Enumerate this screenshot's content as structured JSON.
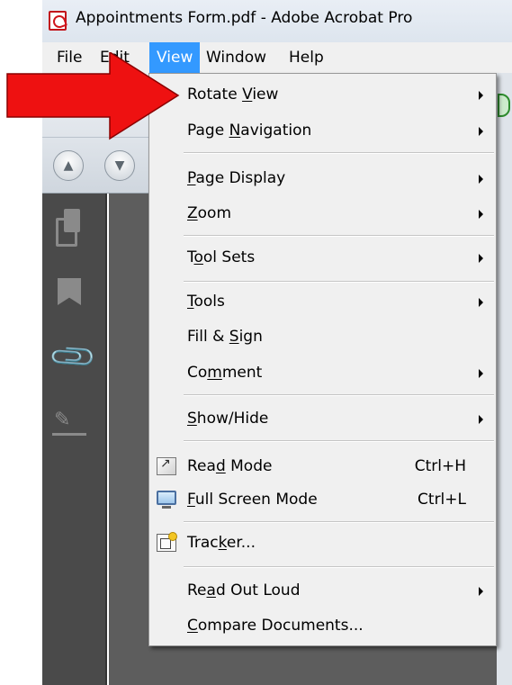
{
  "window": {
    "title": "Appointments Form.pdf - Adobe Acrobat Pro"
  },
  "menubar": {
    "items": [
      {
        "label": "File"
      },
      {
        "label": "Edit"
      },
      {
        "label": "View",
        "active": true
      },
      {
        "label": "Window"
      },
      {
        "label": "Help"
      }
    ]
  },
  "view_menu": {
    "items": [
      {
        "label_pre": "Rotate ",
        "mnemonic": "V",
        "label_post": "iew",
        "submenu": true
      },
      {
        "label_pre": "Page ",
        "mnemonic": "N",
        "label_post": "avigation",
        "submenu": true
      },
      {
        "label_pre": "",
        "mnemonic": "P",
        "label_post": "age Display",
        "submenu": true
      },
      {
        "label_pre": "",
        "mnemonic": "Z",
        "label_post": "oom",
        "submenu": true
      },
      {
        "label_pre": "T",
        "mnemonic": "o",
        "label_post": "ol Sets",
        "submenu": true
      },
      {
        "label_pre": "",
        "mnemonic": "T",
        "label_post": "ools",
        "submenu": true
      },
      {
        "label_pre": "Fill & ",
        "mnemonic": "S",
        "label_post": "ign",
        "submenu": false
      },
      {
        "label_pre": "Co",
        "mnemonic": "m",
        "label_post": "ment",
        "submenu": true
      },
      {
        "label_pre": "",
        "mnemonic": "S",
        "label_post": "how/Hide",
        "submenu": true
      },
      {
        "label_pre": "Rea",
        "mnemonic": "d",
        "label_post": " Mode",
        "shortcut": "Ctrl+H",
        "icon": "read-mode-icon"
      },
      {
        "label_pre": "",
        "mnemonic": "F",
        "label_post": "ull Screen Mode",
        "shortcut": "Ctrl+L",
        "icon": "full-screen-icon"
      },
      {
        "label_pre": "Trac",
        "mnemonic": "k",
        "label_post": "er...",
        "icon": "tracker-icon"
      },
      {
        "label_pre": "Re",
        "mnemonic": "a",
        "label_post": "d Out Loud",
        "submenu": true
      },
      {
        "label_pre": "",
        "mnemonic": "C",
        "label_post": "ompare Documents...",
        "submenu": false
      }
    ]
  },
  "colors": {
    "menu_highlight": "#3399ff",
    "annotation_arrow": "#ee1111",
    "nav_pane": "#4a4a4a"
  }
}
